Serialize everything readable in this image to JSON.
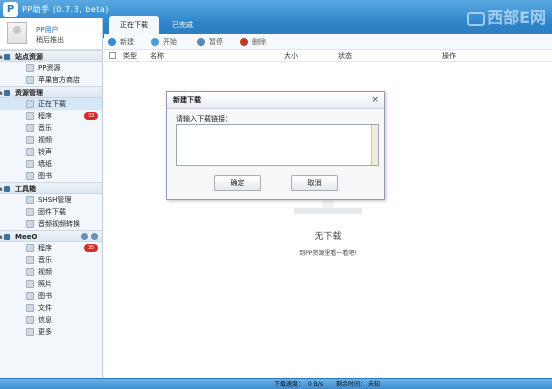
{
  "app": {
    "logo_text": "P",
    "title": "PP助手 (0.7.3, beta)",
    "watermark": "西部E网"
  },
  "tabs": [
    {
      "label": "正在下载",
      "active": true
    },
    {
      "label": "已完成",
      "active": false
    }
  ],
  "user": {
    "name": "PP用户",
    "logout": "稍后推出"
  },
  "sidebar": {
    "sections": [
      {
        "label": "站点资源",
        "items": [
          {
            "label": "PP资源"
          },
          {
            "label": "苹果官方商店"
          }
        ]
      },
      {
        "label": "资源管理",
        "items": [
          {
            "label": "正在下载",
            "active": true
          },
          {
            "label": "程序",
            "badge": "33"
          },
          {
            "label": "音乐"
          },
          {
            "label": "视频"
          },
          {
            "label": "铃声"
          },
          {
            "label": "墙纸"
          },
          {
            "label": "图书"
          }
        ]
      },
      {
        "label": "工具箱",
        "items": [
          {
            "label": "SHSH管理"
          },
          {
            "label": "固件下载"
          },
          {
            "label": "音频视频转换"
          }
        ]
      },
      {
        "label": "MeeO",
        "items": [
          {
            "label": "程序",
            "badge": "35"
          },
          {
            "label": "音乐"
          },
          {
            "label": "视频"
          },
          {
            "label": "照片"
          },
          {
            "label": "图书"
          },
          {
            "label": "文件"
          },
          {
            "label": "信息"
          },
          {
            "label": "更多"
          }
        ]
      }
    ]
  },
  "toolbar": {
    "new": "新建",
    "start": "开始",
    "pause": "暂停",
    "delete": "删除"
  },
  "table": {
    "columns": {
      "type": "类型",
      "name": "名称",
      "size": "大小",
      "status": "状态",
      "action": "操作"
    }
  },
  "empty": {
    "title": "无下载",
    "subtitle": "到PP资源里看一看吧!"
  },
  "status": {
    "speed_label": "下载速度：",
    "speed_value": "0 B/s",
    "remaining_label": "剩余时间：",
    "remaining_value": "未知"
  },
  "dialog": {
    "title": "新建下载",
    "close": "×",
    "label": "请输入下载链接：",
    "value": "",
    "ok": "确定",
    "cancel": "取消"
  },
  "colors": {
    "title_bar": "#2f86cc",
    "badge": "#d62b2b",
    "toolbar_new": "#3a8bd0",
    "toolbar_start": "#4a9ee0",
    "toolbar_pause": "#5a8bb8",
    "toolbar_delete": "#c0392b"
  }
}
